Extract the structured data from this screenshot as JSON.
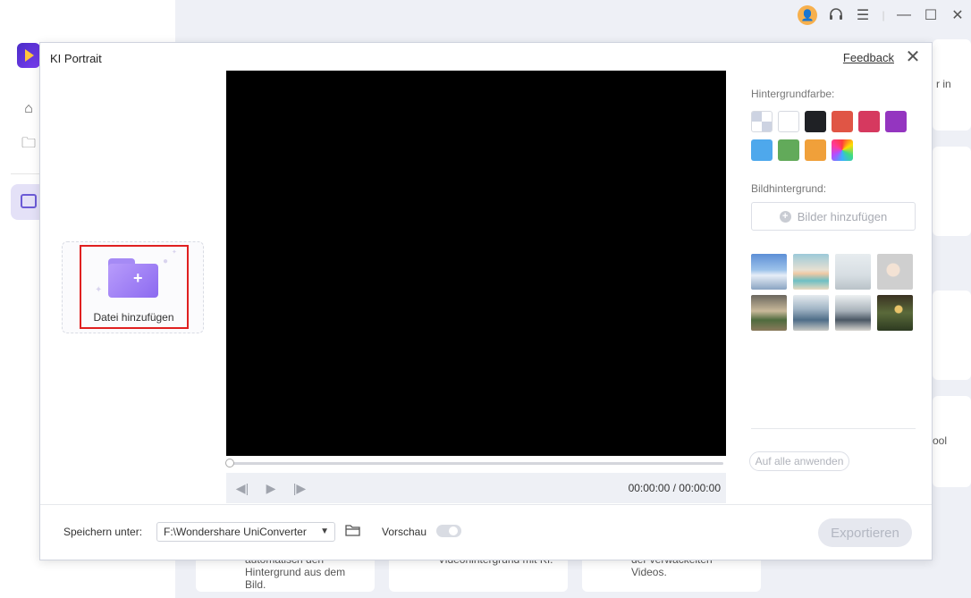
{
  "background": {
    "right_edge_texts": [
      "r in",
      "ool"
    ],
    "bottom_cards": [
      {
        "lines": [
          "automatisch den",
          "Hintergrund aus dem",
          "Bild."
        ]
      },
      {
        "lines": [
          "Videohintergrund mit KI."
        ]
      },
      {
        "lines": [
          "der verwackelten",
          "Videos."
        ]
      }
    ]
  },
  "dialog": {
    "title": "KI Portrait",
    "feedback": "Feedback",
    "add_file_label": "Datei hinzufügen",
    "player": {
      "timecode": "00:00:00 / 00:00:00",
      "progress": 0
    },
    "right_panel": {
      "bg_color_label": "Hintergrundfarbe:",
      "colors": [
        {
          "name": "transparent",
          "hex": "transparent"
        },
        {
          "name": "white",
          "hex": "#ffffff"
        },
        {
          "name": "black",
          "hex": "#1f2125"
        },
        {
          "name": "red",
          "hex": "#e05545"
        },
        {
          "name": "pink",
          "hex": "#d6395f"
        },
        {
          "name": "purple",
          "hex": "#9435c0"
        },
        {
          "name": "blue",
          "hex": "#4ea8ec"
        },
        {
          "name": "green",
          "hex": "#62aa5a"
        },
        {
          "name": "orange",
          "hex": "#f0a03a"
        },
        {
          "name": "rainbow",
          "hex": "gradient"
        }
      ],
      "image_bg_label": "Bildhintergrund:",
      "add_images_label": "Bilder hinzufügen",
      "thumbnails": [
        "snowy-mountains",
        "beach-sunset",
        "white-room",
        "lamp-wall",
        "lobby",
        "office-windows",
        "modern-office",
        "plants-wall"
      ],
      "apply_all_label": "Auf alle anwenden"
    },
    "footer": {
      "save_label": "Speichern unter:",
      "path_value": "F:\\Wondershare UniConverter",
      "preview_label": "Vorschau",
      "preview_on": false,
      "export_label": "Exportieren"
    }
  }
}
